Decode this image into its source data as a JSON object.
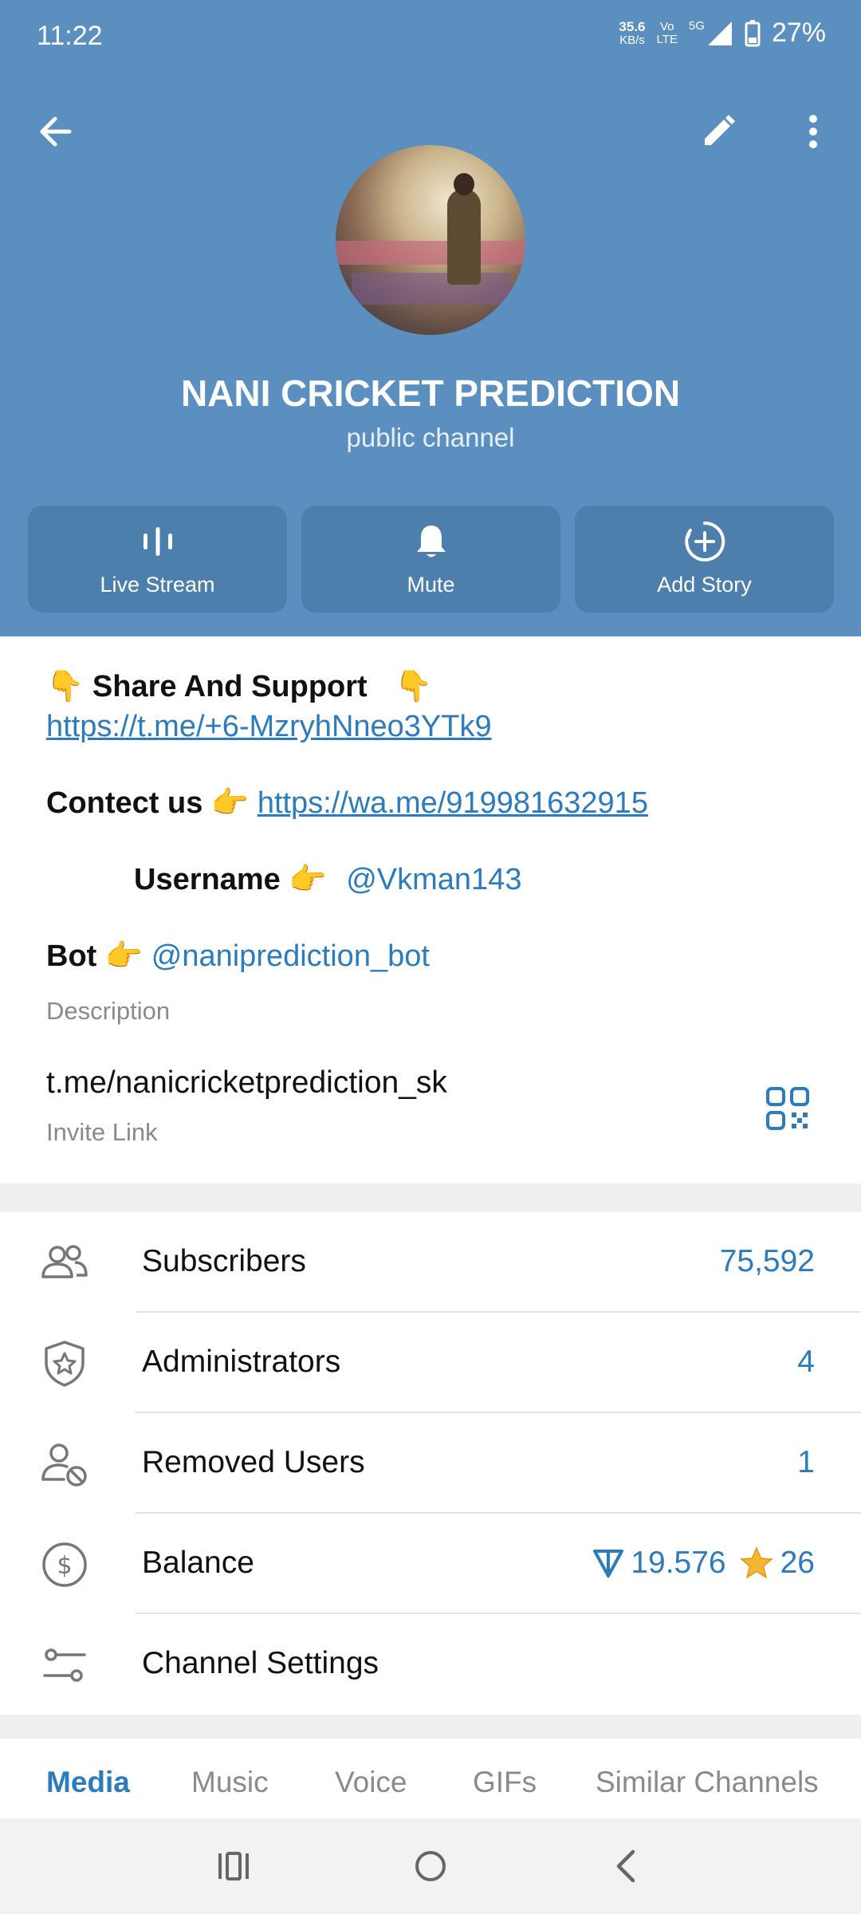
{
  "status": {
    "time": "11:22",
    "speed_value": "35.6",
    "speed_unit": "KB/s",
    "volte_top": "Vo",
    "volte_bottom": "LTE",
    "network": "5G",
    "battery": "27%"
  },
  "channel": {
    "title": "NANI CRICKET PREDICTION",
    "subtitle": "public channel"
  },
  "actions": [
    {
      "label": "Live Stream",
      "icon": "live-stream-icon"
    },
    {
      "label": "Mute",
      "icon": "bell-icon"
    },
    {
      "label": "Add Story",
      "icon": "add-story-icon"
    }
  ],
  "description": {
    "share_emoji_left": "👇",
    "share_text": "Share And Support",
    "share_emoji_right": "👇",
    "share_link": "https://t.me/+6-MzryhNneo3YTk9",
    "contact_text": "Contect us",
    "pointer_emoji": "👉",
    "contact_link": "https://wa.me/919981632915",
    "username_text": "Username",
    "username_value": "@Vkman143",
    "bot_text": "Bot",
    "bot_value": "@naniprediction_bot",
    "label": "Description"
  },
  "invite": {
    "link": "t.me/nanicricketprediction_sk",
    "label": "Invite Link"
  },
  "list": [
    {
      "label": "Subscribers",
      "value": "75,592",
      "icon": "users-icon"
    },
    {
      "label": "Administrators",
      "value": "4",
      "icon": "admin-shield-icon"
    },
    {
      "label": "Removed Users",
      "value": "1",
      "icon": "removed-user-icon"
    },
    {
      "label": "Balance",
      "ton_value": "19.576",
      "stars_value": "26",
      "icon": "dollar-icon"
    },
    {
      "label": "Channel Settings",
      "icon": "settings-sliders-icon"
    }
  ],
  "tabs": [
    "Media",
    "Music",
    "Voice",
    "GIFs",
    "Similar Channels"
  ],
  "colors": {
    "header": "#5b8fbf",
    "button": "#4d7fad",
    "accent": "#2b7bbf"
  }
}
